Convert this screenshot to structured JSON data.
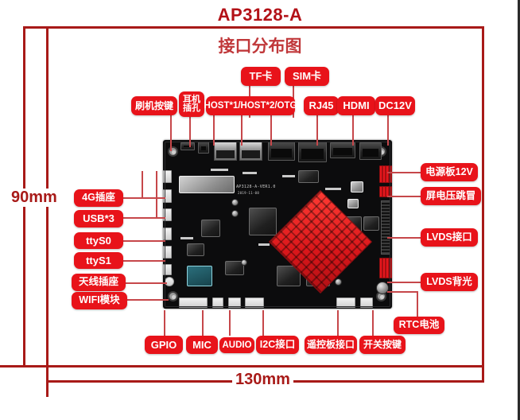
{
  "title": "AP3128-A",
  "subtitle": "接口分布图",
  "dimensions": {
    "height_label": "90mm",
    "width_label": "130mm"
  },
  "board": {
    "silkscreen": "AP3128-A-VER1.0",
    "silkscreen_sub": "2019-11-08",
    "color": "#0c0c0d",
    "heatsink_color": "#d9161a"
  },
  "colors": {
    "label_red": "#e8131a",
    "line_red": "#a81a18",
    "title_red": "#b31117"
  },
  "labels": {
    "top": [
      {
        "id": "tf-card",
        "text": "TF卡"
      },
      {
        "id": "sim-card",
        "text": "SIM卡"
      },
      {
        "id": "flash-key",
        "text": "刷机按键"
      },
      {
        "id": "earphone",
        "text": "耳机插孔"
      },
      {
        "id": "usb-host",
        "text": "HOST*1/HOST*2/OTG"
      },
      {
        "id": "rj45",
        "text": "RJ45"
      },
      {
        "id": "hdmi",
        "text": "HDMI"
      },
      {
        "id": "dc12v",
        "text": "DC12V"
      }
    ],
    "left": [
      {
        "id": "4g-socket",
        "text": "4G插座"
      },
      {
        "id": "usb3",
        "text": "USB*3"
      },
      {
        "id": "ttys0",
        "text": "ttyS0"
      },
      {
        "id": "ttys1",
        "text": "ttyS1"
      },
      {
        "id": "ant-socket",
        "text": "天线插座"
      },
      {
        "id": "wifi-module",
        "text": "WIFI模块"
      }
    ],
    "right": [
      {
        "id": "power-board-12v",
        "text": "电源板12V"
      },
      {
        "id": "screen-voltage",
        "text": "屏电压跳冒"
      },
      {
        "id": "lvds-port",
        "text": "LVDS接口"
      },
      {
        "id": "lvds-backlight",
        "text": "LVDS背光"
      },
      {
        "id": "rtc-battery",
        "text": "RTC电池"
      }
    ],
    "bottom": [
      {
        "id": "gpio",
        "text": "GPIO"
      },
      {
        "id": "mic",
        "text": "MIC"
      },
      {
        "id": "audio",
        "text": "AUDIO"
      },
      {
        "id": "i2c",
        "text": "I2C接口"
      },
      {
        "id": "remote-board",
        "text": "遥控板接口"
      },
      {
        "id": "power-key",
        "text": "开关按键"
      }
    ]
  }
}
